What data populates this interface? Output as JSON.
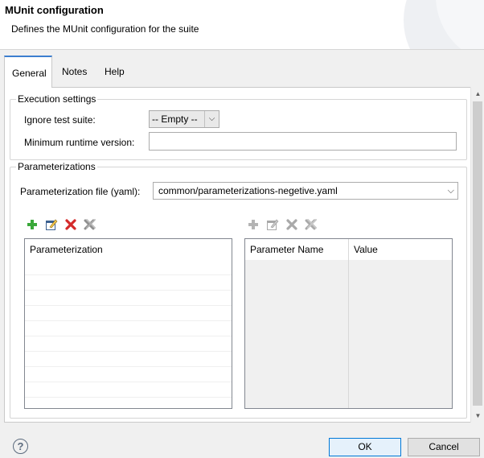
{
  "dialog": {
    "title": "MUnit configuration",
    "description": "Defines the MUnit configuration for the suite"
  },
  "tabs": [
    {
      "label": "General",
      "active": true
    },
    {
      "label": "Notes",
      "active": false
    },
    {
      "label": "Help",
      "active": false
    }
  ],
  "execution_settings": {
    "legend": "Execution settings",
    "ignore_label": "Ignore test suite:",
    "ignore_value": "-- Empty --",
    "min_runtime_label": "Minimum runtime version:",
    "min_runtime_value": ""
  },
  "parameterizations": {
    "legend": "Parameterizations",
    "file_label": "Parameterization file (yaml):",
    "file_value": "common/parameterizations-negetive.yaml",
    "left_table": {
      "columns": [
        "Parameterization"
      ],
      "rows": []
    },
    "right_table": {
      "columns": [
        "Parameter Name",
        "Value"
      ],
      "rows": []
    },
    "toolbar_icons": [
      "add-icon",
      "edit-icon",
      "delete-icon",
      "clear-icon"
    ]
  },
  "buttons": {
    "ok": "OK",
    "cancel": "Cancel",
    "help_symbol": "?"
  },
  "colors": {
    "accent": "#3c7ecf",
    "add_green": "#3aa83a",
    "delete_red": "#d42a2a"
  }
}
